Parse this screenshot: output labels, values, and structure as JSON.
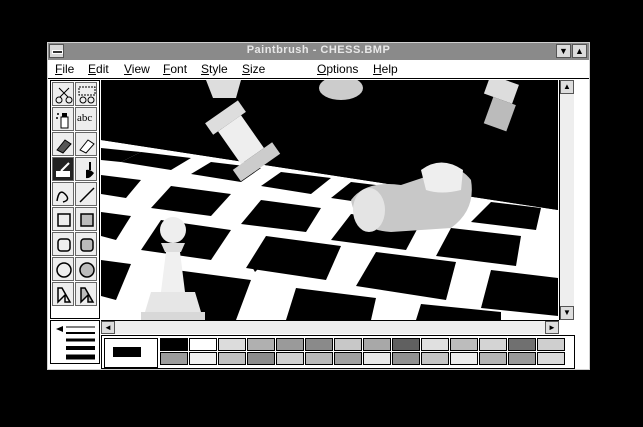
{
  "window": {
    "title": "Paintbrush - CHESS.BMP"
  },
  "titlebar_buttons": {
    "minimize": "▼",
    "maximize": "▲"
  },
  "menu": [
    {
      "label": "File",
      "key": "F"
    },
    {
      "label": "Edit",
      "key": "E"
    },
    {
      "label": "View",
      "key": "V"
    },
    {
      "label": "Font",
      "key": "F"
    },
    {
      "label": "Style",
      "key": "S"
    },
    {
      "label": "Size",
      "key": "S"
    },
    {
      "label": "Options",
      "key": "O"
    },
    {
      "label": "Help",
      "key": "H"
    }
  ],
  "tools": [
    {
      "name": "scissors-tool"
    },
    {
      "name": "pick-tool"
    },
    {
      "name": "spraycan-tool"
    },
    {
      "name": "text-tool",
      "label": "abc"
    },
    {
      "name": "color-eraser-tool"
    },
    {
      "name": "eraser-tool"
    },
    {
      "name": "paint-roller-tool",
      "selected": true
    },
    {
      "name": "brush-tool"
    },
    {
      "name": "curve-tool"
    },
    {
      "name": "line-tool"
    },
    {
      "name": "box-tool"
    },
    {
      "name": "filled-box-tool"
    },
    {
      "name": "rounded-box-tool"
    },
    {
      "name": "filled-rounded-box-tool"
    },
    {
      "name": "circle-tool"
    },
    {
      "name": "filled-circle-tool"
    },
    {
      "name": "polygon-tool"
    },
    {
      "name": "filled-polygon-tool"
    }
  ],
  "scroll_arrows": {
    "up": "▲",
    "down": "▼",
    "left": "◄",
    "right": "►"
  },
  "palette": {
    "foreground": "#000000",
    "background": "#ffffff",
    "colors": [
      "#000000",
      "#ffffff",
      "#dcdcdc",
      "#b0b0b0",
      "#9a9a9a",
      "#8a8a8a",
      "#c8c8c8",
      "#a8a8a8",
      "#606060",
      "#e0e0e0",
      "#bcbcbc",
      "#d4d4d4",
      "#707070",
      "#cfcfcf",
      "#9c9c9c",
      "#f0f0f0",
      "#c0c0c0",
      "#8c8c8c",
      "#d0d0d0",
      "#b8b8b8",
      "#a0a0a0",
      "#e8e8e8",
      "#909090",
      "#c4c4c4",
      "#ececec",
      "#b4b4b4",
      "#989898",
      "#dadada"
    ]
  }
}
